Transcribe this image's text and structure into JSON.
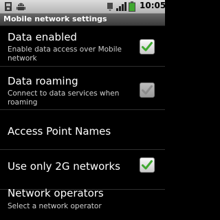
{
  "status_bar": {
    "time": "10:05",
    "icons": [
      "usb-icon",
      "android-debug-icon",
      "notification-icon",
      "signal-icon",
      "battery-icon"
    ]
  },
  "title_bar": {
    "title": "Mobile network settings"
  },
  "settings": [
    {
      "title": "Data enabled",
      "summary": "Enable data access over Mobile network",
      "checked": true,
      "enabled": true
    },
    {
      "title": "Data roaming",
      "summary": "Connect to data services when roaming",
      "checked": true,
      "enabled": false
    },
    {
      "title": "Access Point Names",
      "summary": "",
      "checked": null,
      "enabled": true
    },
    {
      "title": "Use only 2G networks",
      "summary": "",
      "checked": true,
      "enabled": true
    },
    {
      "title": "Network operators",
      "summary": "Select a network operator",
      "checked": null,
      "enabled": true
    }
  ],
  "colors": {
    "check_green": "#3fa82f",
    "check_disabled": "#8c8c8c",
    "background": "#000000"
  }
}
